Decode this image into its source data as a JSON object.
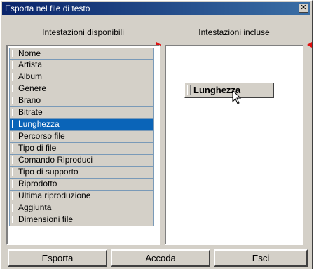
{
  "window": {
    "title": "Esporta nel file di testo"
  },
  "headings": {
    "available": "Intestazioni disponibili",
    "included": "Intestazioni incluse"
  },
  "available_list": [
    "Nome",
    "Artista",
    "Album",
    "Genere",
    "Brano",
    "Bitrate",
    "Lunghezza",
    "Percorso file",
    "Tipo di file",
    "Comando Riproduci",
    "Tipo di supporto",
    "Riprodotto",
    "Ultima riproduzione",
    "Aggiunta",
    "Dimensioni file"
  ],
  "selected_item": "Lunghezza",
  "dragged_header": "Lunghezza",
  "buttons": {
    "export": "Esporta",
    "append": "Accoda",
    "exit": "Esci"
  },
  "icons": {
    "close": "close-icon",
    "drop_arrows": "red-arrow-icon",
    "cursor": "arrow-cursor-icon"
  },
  "colors": {
    "selection": "#0a64b8",
    "title_bar": "#0a246a",
    "drop_arrow": "#e01010"
  }
}
